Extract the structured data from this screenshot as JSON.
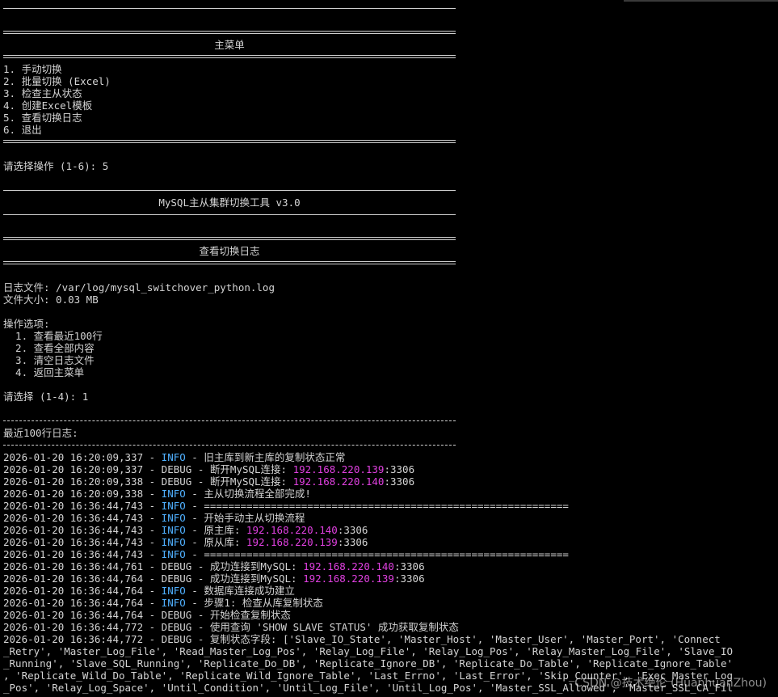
{
  "main_menu": {
    "title": "主菜单",
    "items": [
      "1. 手动切换",
      "2. 批量切换 (Excel)",
      "3. 检查主从状态",
      "4. 创建Excel模板",
      "5. 查看切换日志",
      "6. 退出"
    ],
    "prompt": "请选择操作 (1-6): 5"
  },
  "app_title": "MySQL主从集群切换工具 v3.0",
  "log_view": {
    "title": "查看切换日志",
    "file_line": "日志文件: /var/log/mysql_switchover_python.log",
    "size_line": "文件大小: 0.03 MB",
    "options_title": "操作选项:",
    "options": [
      "  1. 查看最近100行",
      "  2. 查看全部内容",
      "  3. 清空日志文件",
      "  4. 返回主菜单"
    ],
    "prompt": "请选择 (1-4): 1",
    "recent_title": "最近100行日志:"
  },
  "log_lines": [
    {
      "ts": "2026-01-20 16:20:09,337",
      "level": "INFO",
      "pre": "旧主库到新主库的复制状态正常",
      "ip": "",
      "post": ""
    },
    {
      "ts": "2026-01-20 16:20:09,337",
      "level": "DEBUG",
      "pre": "断开MySQL连接: ",
      "ip": "192.168.220.139",
      "post": ":3306"
    },
    {
      "ts": "2026-01-20 16:20:09,338",
      "level": "DEBUG",
      "pre": "断开MySQL连接: ",
      "ip": "192.168.220.140",
      "post": ":3306"
    },
    {
      "ts": "2026-01-20 16:20:09,338",
      "level": "INFO",
      "pre": "主从切换流程全部完成!",
      "ip": "",
      "post": ""
    },
    {
      "ts": "2026-01-20 16:36:44,743",
      "level": "INFO",
      "pre": "============================================================",
      "ip": "",
      "post": ""
    },
    {
      "ts": "2026-01-20 16:36:44,743",
      "level": "INFO",
      "pre": "开始手动主从切换流程",
      "ip": "",
      "post": ""
    },
    {
      "ts": "2026-01-20 16:36:44,743",
      "level": "INFO",
      "pre": "原主库: ",
      "ip": "192.168.220.140",
      "post": ":3306"
    },
    {
      "ts": "2026-01-20 16:36:44,743",
      "level": "INFO",
      "pre": "原从库: ",
      "ip": "192.168.220.139",
      "post": ":3306"
    },
    {
      "ts": "2026-01-20 16:36:44,743",
      "level": "INFO",
      "pre": "============================================================",
      "ip": "",
      "post": ""
    },
    {
      "ts": "2026-01-20 16:36:44,761",
      "level": "DEBUG",
      "pre": "成功连接到MySQL: ",
      "ip": "192.168.220.140",
      "post": ":3306"
    },
    {
      "ts": "2026-01-20 16:36:44,764",
      "level": "DEBUG",
      "pre": "成功连接到MySQL: ",
      "ip": "192.168.220.139",
      "post": ":3306"
    },
    {
      "ts": "2026-01-20 16:36:44,764",
      "level": "INFO",
      "pre": "数据库连接成功建立",
      "ip": "",
      "post": ""
    },
    {
      "ts": "2026-01-20 16:36:44,764",
      "level": "INFO",
      "pre": "步骤1: 检查从库复制状态",
      "ip": "",
      "post": ""
    },
    {
      "ts": "2026-01-20 16:36:44,764",
      "level": "DEBUG",
      "pre": "开始检查复制状态",
      "ip": "",
      "post": ""
    },
    {
      "ts": "2026-01-20 16:36:44,772",
      "level": "DEBUG",
      "pre": "使用查询 'SHOW SLAVE STATUS' 成功获取复制状态",
      "ip": "",
      "post": ""
    },
    {
      "ts": "2026-01-20 16:36:44,772",
      "level": "DEBUG",
      "pre": "复制状态字段: ['Slave_IO_State', 'Master_Host', 'Master_User', 'Master_Port', 'Connect",
      "ip": "",
      "post": ""
    }
  ],
  "wrapped_lines": [
    "_Retry', 'Master_Log_File', 'Read_Master_Log_Pos', 'Relay_Log_File', 'Relay_Log_Pos', 'Relay_Master_Log_File', 'Slave_IO",
    "_Running', 'Slave_SQL_Running', 'Replicate_Do_DB', 'Replicate_Ignore_DB', 'Replicate_Do_Table', 'Replicate_Ignore_Table'",
    ", 'Replicate_Wild_Do_Table', 'Replicate_Wild_Ignore_Table', 'Last_Errno', 'Last_Error', 'Skip_Counter', 'Exec_Master_Log",
    "_Pos', 'Relay_Log_Space', 'Until_Condition', 'Until_Log_File', 'Until_Log_Pos', 'Master_SSL_Allowed', 'Master_SSL_CA_Fil"
  ],
  "watermark": "CSDN @技术绝伦 (HuanhuanZhou)",
  "colors": {
    "info": "#4fb0ff",
    "ip": "#e040e0",
    "text": "#d4d4d4",
    "background": "#000000"
  }
}
